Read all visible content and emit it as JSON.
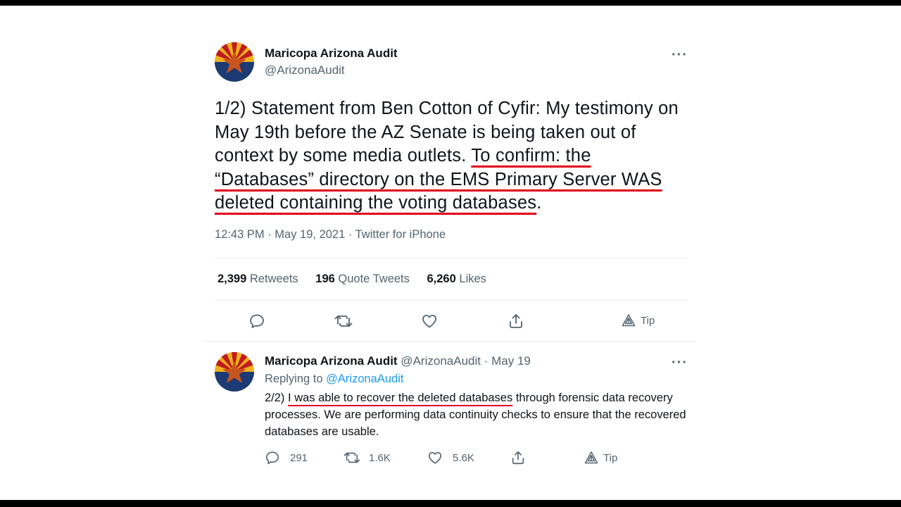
{
  "main_tweet": {
    "author_name": "Maricopa Arizona Audit",
    "author_handle": "@ArizonaAudit",
    "more_label": "···",
    "text_plain_1": "1/2) Statement from Ben Cotton of Cyfir: My testimony on May 19th before the AZ Senate is being taken out of context by some media outlets. ",
    "text_underlined": "To confirm: the “Databases” directory on the EMS Primary Server WAS deleted containing the voting databases",
    "text_plain_2": ".",
    "timestamp": "12:43 PM · May 19, 2021 · Twitter for iPhone",
    "stats": {
      "retweets_count": "2,399",
      "retweets_label": "Retweets",
      "quote_count": "196",
      "quote_label": "Quote Tweets",
      "likes_count": "6,260",
      "likes_label": "Likes"
    },
    "actions": {
      "tip_label": "Tip"
    }
  },
  "reply_tweet": {
    "author_name": "Maricopa Arizona Audit",
    "author_handle": "@ArizonaAudit",
    "date": "· May 19",
    "more_label": "···",
    "replying_to_label": "Replying to",
    "replying_to_handle": "@ArizonaAudit",
    "text_prefix": "2/2) ",
    "text_underlined": "I was able to recover the deleted databases",
    "text_rest": " through forensic data recovery processes. We are performing data continuity checks to ensure that the recovered databases are usable.",
    "actions": {
      "reply_count": "291",
      "retweet_count": "1.6K",
      "like_count": "5.6K",
      "tip_label": "Tip"
    }
  },
  "colors": {
    "underline": "#e0001b",
    "link": "#1d9bf0",
    "secondary_text": "#536471",
    "avatar_navy": "#1c3a73",
    "avatar_star": "#c8541e",
    "avatar_ray_red": "#bf1b20",
    "avatar_ray_gold": "#f2b01e"
  }
}
